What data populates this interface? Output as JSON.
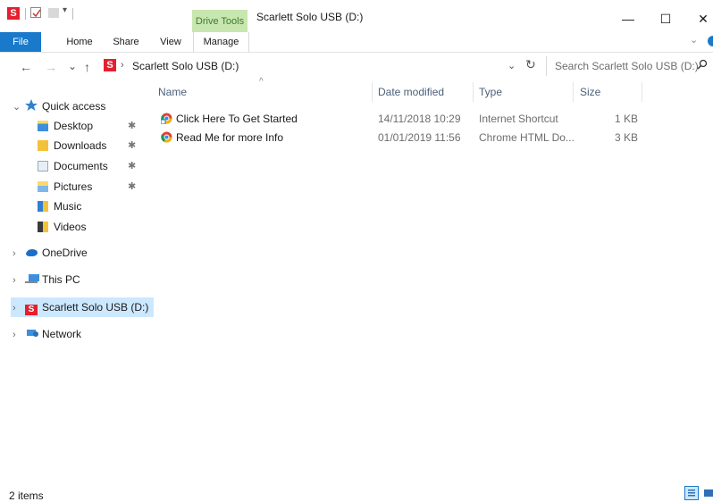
{
  "window": {
    "title": "Scarlett Solo USB (D:)",
    "app_icon_letter": "S",
    "minimize_glyph": "—",
    "maximize_glyph": "☐",
    "close_glyph": "✕",
    "context_tab": "Drive Tools"
  },
  "ribbon": {
    "tabs": [
      "File",
      "Home",
      "Share",
      "View",
      "Manage"
    ]
  },
  "address": {
    "back_glyph": "←",
    "forward_glyph": "→",
    "recent_glyph": "⌄",
    "up_glyph": "↑",
    "separator": "›",
    "path": "Scarlett Solo USB (D:)",
    "dropdown_glyph": "⌄",
    "refresh_glyph": "↻"
  },
  "search": {
    "placeholder": "Search Scarlett Solo USB (D:)"
  },
  "sidebar": {
    "quick_access": "Quick access",
    "quick_items": [
      {
        "label": "Desktop",
        "icon": "desktop-folder-icon",
        "pinned": true
      },
      {
        "label": "Downloads",
        "icon": "downloads-folder-icon",
        "pinned": true
      },
      {
        "label": "Documents",
        "icon": "documents-folder-icon",
        "pinned": true
      },
      {
        "label": "Pictures",
        "icon": "pictures-folder-icon",
        "pinned": true
      },
      {
        "label": "Music",
        "icon": "music-folder-icon",
        "pinned": false
      },
      {
        "label": "Videos",
        "icon": "videos-folder-icon",
        "pinned": false
      }
    ],
    "onedrive": "OneDrive",
    "this_pc": "This PC",
    "drive": "Scarlett Solo USB (D:)",
    "network": "Network",
    "expand_glyph": "›",
    "collapse_glyph": "⌄",
    "pin_glyph": "✱"
  },
  "columns": {
    "name": "Name",
    "date": "Date modified",
    "type": "Type",
    "size": "Size",
    "sort_glyph": "^"
  },
  "files": [
    {
      "name": "Click Here To Get Started",
      "date": "14/11/2018 10:29",
      "type": "Internet Shortcut",
      "size": "1 KB"
    },
    {
      "name": "Read Me for more Info",
      "date": "01/01/2019 11:56",
      "type": "Chrome HTML Do...",
      "size": "3 KB"
    }
  ],
  "status": {
    "item_count": "2 items"
  },
  "colors": {
    "accent": "#1979ca",
    "selection": "#cce8ff",
    "drive_tools": "#c8e6b0",
    "brand_red": "#e5202e"
  }
}
